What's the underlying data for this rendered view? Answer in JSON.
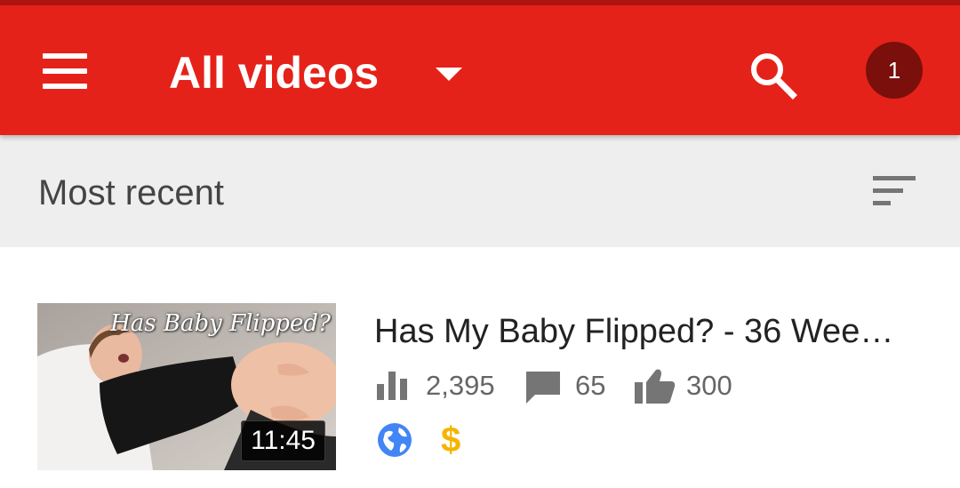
{
  "app_bar": {
    "title": "All videos",
    "notification_count": "1",
    "colors": {
      "bar": "#e52219",
      "avatar": "#7a0f0c"
    }
  },
  "sort_bar": {
    "label": "Most recent"
  },
  "videos": [
    {
      "title": "Has My Baby Flipped? - 36 Wee…",
      "thumbnail_text": "Has Baby Flipped?",
      "duration": "11:45",
      "views": "2,395",
      "comments": "65",
      "likes": "300",
      "visibility_icon": "globe-icon",
      "monetization_icon": "dollar-icon",
      "monetization_symbol": "$"
    }
  ]
}
